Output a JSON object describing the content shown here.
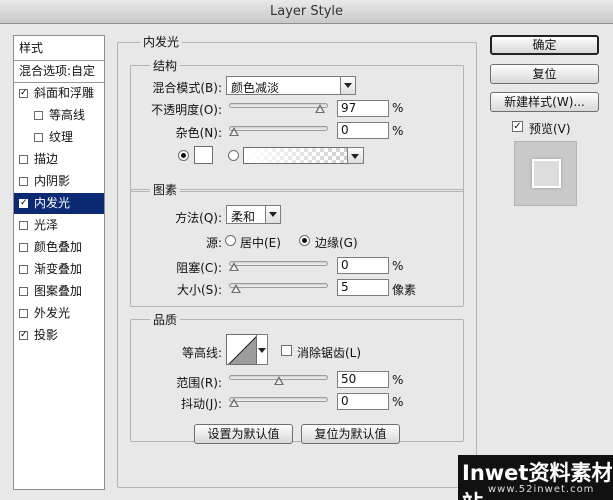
{
  "window": {
    "title": "Layer Style"
  },
  "styles_list": {
    "items": [
      {
        "label": "样式",
        "type": "header"
      },
      {
        "label": "混合选项:自定",
        "type": "header"
      },
      {
        "label": "斜面和浮雕",
        "checked": "✓"
      },
      {
        "label": "等高线",
        "checked": "",
        "indent": true
      },
      {
        "label": "纹理",
        "checked": "",
        "indent": true
      },
      {
        "label": "描边",
        "checked": ""
      },
      {
        "label": "内阴影",
        "checked": ""
      },
      {
        "label": "内发光",
        "checked": "✓",
        "selected": true
      },
      {
        "label": "光泽",
        "checked": ""
      },
      {
        "label": "颜色叠加",
        "checked": ""
      },
      {
        "label": "渐变叠加",
        "checked": ""
      },
      {
        "label": "图案叠加",
        "checked": ""
      },
      {
        "label": "外发光",
        "checked": ""
      },
      {
        "label": "投影",
        "checked": "✓"
      }
    ]
  },
  "panel": {
    "title": "内发光",
    "structure": {
      "title": "结构",
      "blend_mode_label": "混合模式(B):",
      "blend_mode_value": "颜色减淡",
      "opacity_label": "不透明度(O):",
      "opacity_value": "97",
      "opacity_unit": "%",
      "opacity_level": 0.97,
      "noise_label": "杂色(N):",
      "noise_value": "0",
      "noise_unit": "%",
      "noise_level": 0.0,
      "color_swatch": "#ffffff"
    },
    "elements": {
      "title": "图素",
      "technique_label": "方法(Q):",
      "technique_value": "柔和",
      "source_label": "源:",
      "source_center": "居中(E)",
      "source_edge": "边缘(G)",
      "choke_label": "阻塞(C):",
      "choke_value": "0",
      "choke_unit": "%",
      "choke_level": 0.0,
      "size_label": "大小(S):",
      "size_value": "5",
      "size_unit": "像素",
      "size_level": 0.02
    },
    "quality": {
      "title": "品质",
      "contour_label": "等高线:",
      "antialias_label": "消除锯齿(L)",
      "range_label": "范围(R):",
      "range_value": "50",
      "range_unit": "%",
      "range_level": 0.5,
      "jitter_label": "抖动(J):",
      "jitter_value": "0",
      "jitter_unit": "%",
      "jitter_level": 0.0
    },
    "make_default": "设置为默认值",
    "reset_default": "复位为默认值"
  },
  "buttons": {
    "ok": "确定",
    "reset": "复位",
    "new_style": "新建样式(W)...",
    "preview": "预览(V)",
    "preview_checked": "✓"
  },
  "watermark": {
    "line1": "Inwet资料素材站",
    "line2": "www.52inwet.com"
  }
}
